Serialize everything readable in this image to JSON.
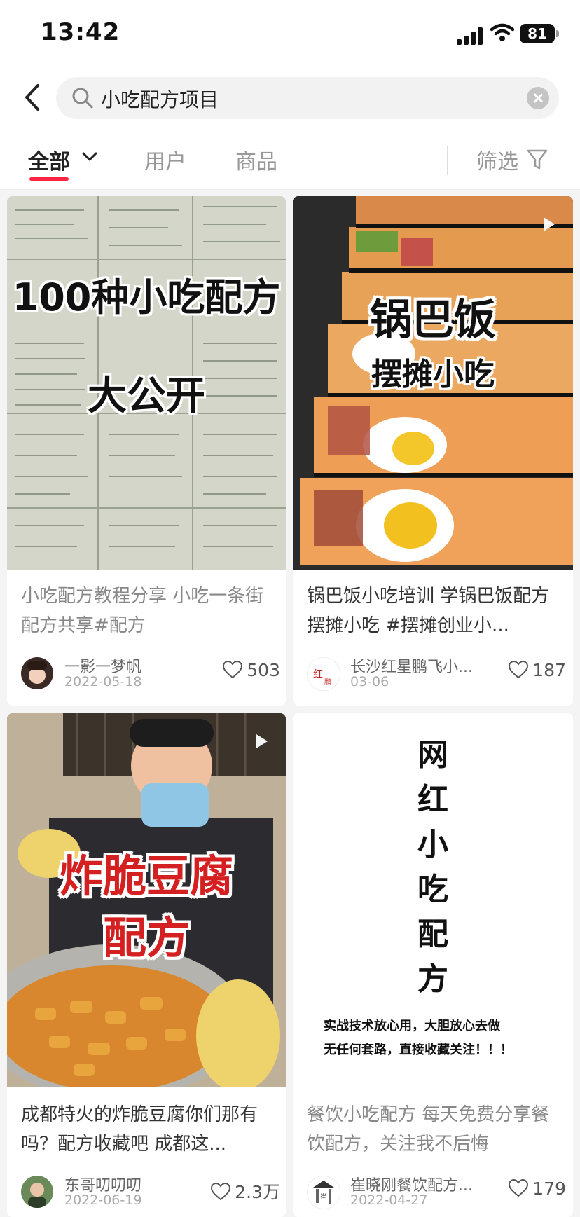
{
  "status": {
    "time": "13:42",
    "battery": "81"
  },
  "search": {
    "query": "小吃配方项目"
  },
  "tabs": {
    "all": "全部",
    "users": "用户",
    "goods": "商品",
    "filter": "筛选"
  },
  "cards": [
    {
      "thumb_line1": "100种小吃配方",
      "thumb_line2": "大公开",
      "title": "小吃配方教程分享 小吃一条街配方共享#配方",
      "author": "一影一梦帆",
      "date": "2022-05-18",
      "likes": "503"
    },
    {
      "thumb_line1": "锅巴饭",
      "thumb_line2": "摆摊小吃",
      "title": "锅巴饭小吃培训 学锅巴饭配方 摆摊小吃 #摆摊创业小...",
      "author": "长沙红星鹏飞小...",
      "date": "03-06",
      "likes": "187"
    },
    {
      "thumb_line1": "炸脆豆腐",
      "thumb_line2": "配方",
      "title": "成都特火的炸脆豆腐你们那有吗？配方收藏吧 成都这...",
      "author": "东哥叨叨叨",
      "date": "2022-06-19",
      "likes": "2.3万"
    },
    {
      "thumb_vertical": [
        "网",
        "红",
        "小",
        "吃",
        "配",
        "方"
      ],
      "thumb_note1": "实战技术放心用，大胆放心去做",
      "thumb_note2": "无任何套路，直接收藏关注！！！",
      "title": "餐饮小吃配方 每天免费分享餐饮配方，关注我不后悔",
      "author": "崔晓刚餐饮配方...",
      "date": "2022-04-27",
      "likes": "179"
    }
  ]
}
